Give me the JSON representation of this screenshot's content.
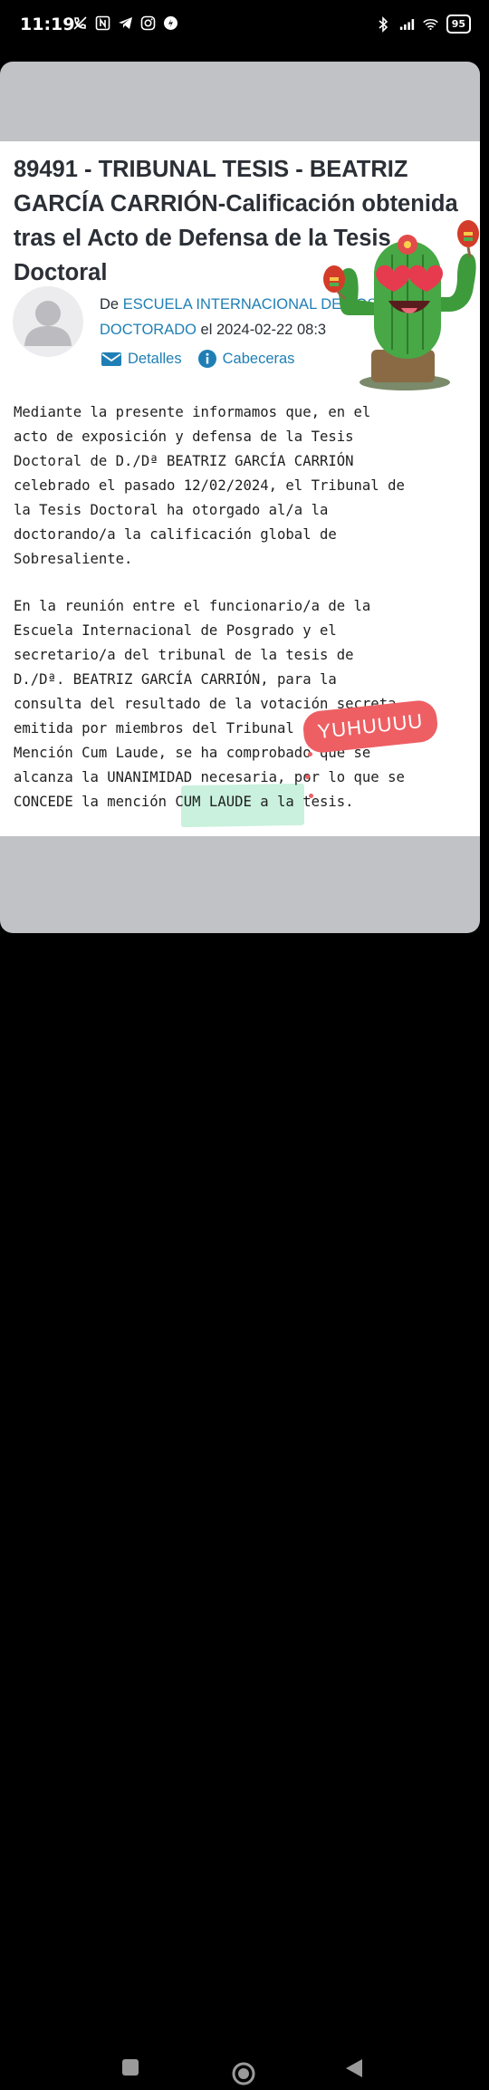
{
  "status_bar": {
    "time": "11:19",
    "battery": "95"
  },
  "email": {
    "title": "89491 - TRIBUNAL TESIS - BEATRIZ GARCÍA CARRIÓN-Calificación obtenida tras el Acto de Defensa de la Tesis Doctoral",
    "from_prefix": "De",
    "from_sender": "ESCUELA INTERNACIONAL DE POSGRADO - DOCTORADO",
    "date_prefix": "el",
    "date": "2024-02-22 08:3",
    "actions": {
      "details": "Detalles",
      "headers": "Cabeceras"
    },
    "paragraph_1": "Mediante la presente informamos que, en el\nacto de exposición y defensa de la Tesis\nDoctoral de D./Dª BEATRIZ GARCÍA CARRIÓN\ncelebrado el pasado 12/02/2024, el Tribunal de\nla Tesis Doctoral ha otorgado al/a la\ndoctorando/a la calificación global de\nSobresaliente.",
    "paragraph_2": "En la reunión entre el funcionario/a de la\nEscuela Internacional de Posgrado y el\nsecretario/a del tribunal de la tesis de\nD./Dª. BEATRIZ GARCÍA CARRIÓN, para la\nconsulta del resultado de la votación secreta\nemitida por miembros del Tribunal para la\nMención Cum Laude, se ha comprobado que se\nalcanza la UNANIMIDAD necesaria, por lo que se\nCONCEDE la mención CUM LAUDE a la tesis."
  },
  "stickers": {
    "yuhu": "YUHUUUU",
    "cactus": "cactus-with-heart-sunglasses-and-maracas"
  },
  "colors": {
    "link": "#1f7fb5",
    "highlight": "#bfeed8",
    "sticker": "#ee5f63",
    "card_bg": "#c0c2c6"
  }
}
